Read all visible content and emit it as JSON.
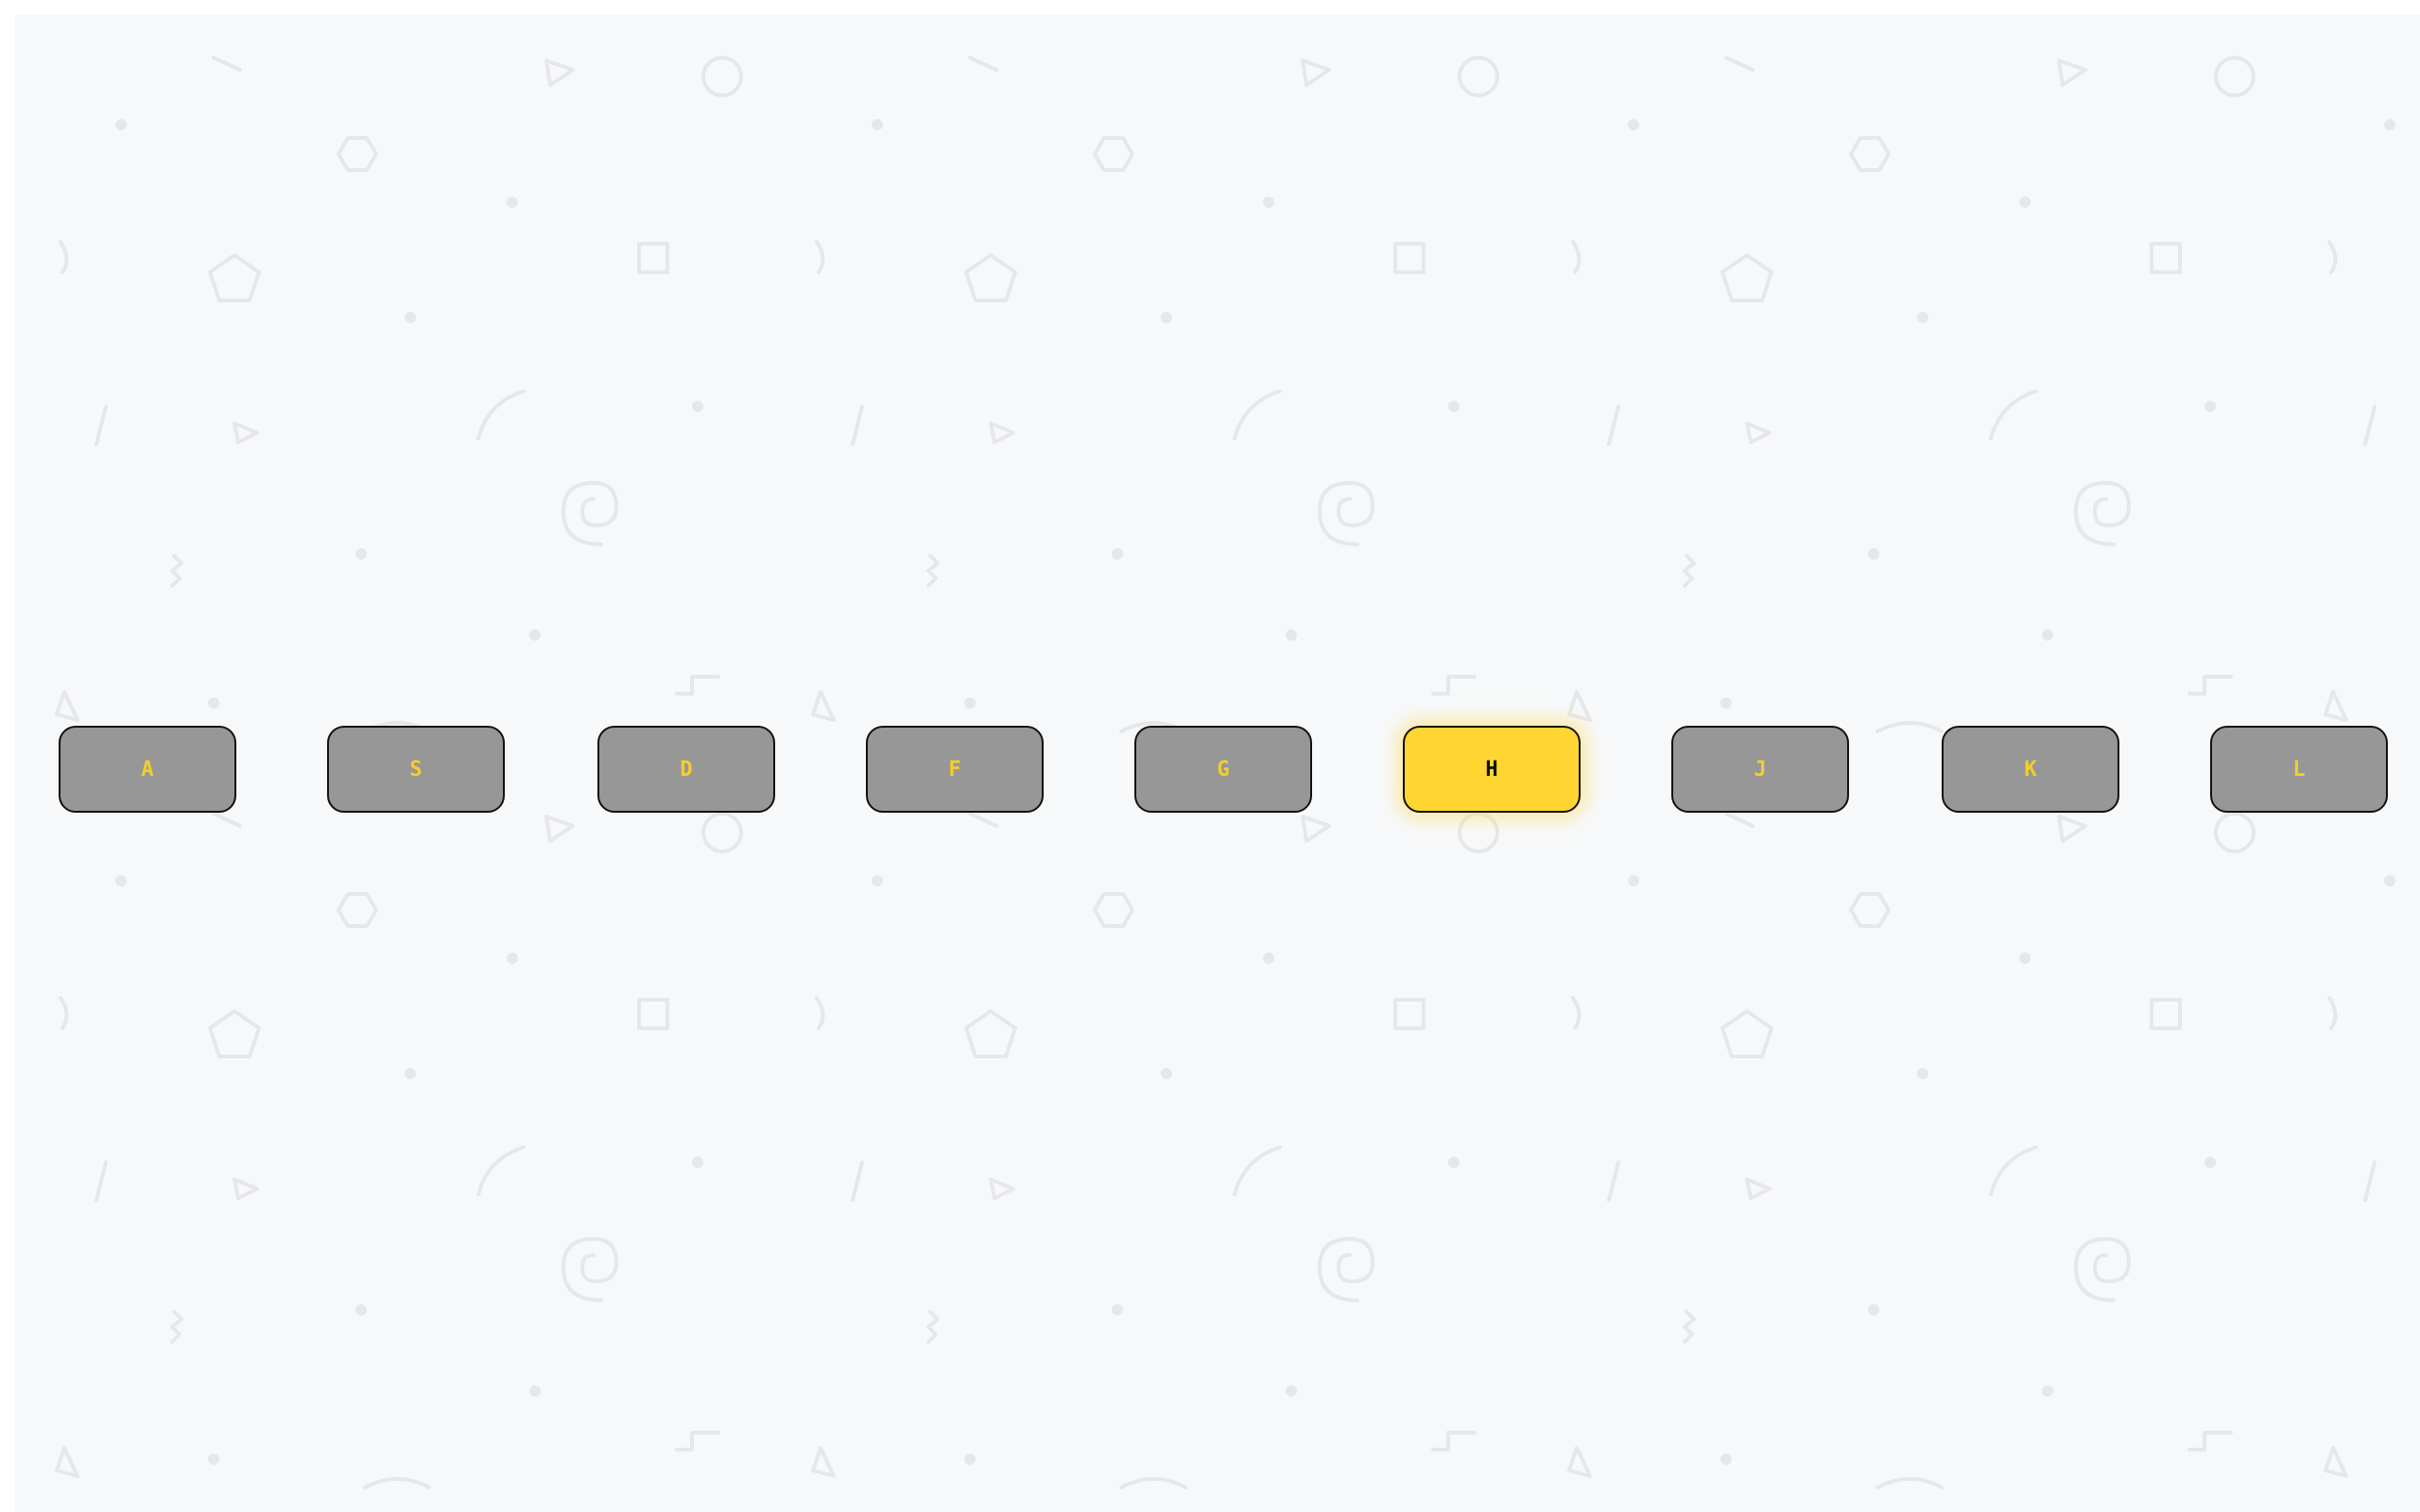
{
  "keyboard": {
    "keys": [
      {
        "label": "A",
        "active": false
      },
      {
        "label": "S",
        "active": false
      },
      {
        "label": "D",
        "active": false
      },
      {
        "label": "F",
        "active": false
      },
      {
        "label": "G",
        "active": false
      },
      {
        "label": "H",
        "active": true
      },
      {
        "label": "J",
        "active": false
      },
      {
        "label": "K",
        "active": false
      },
      {
        "label": "L",
        "active": false
      }
    ]
  },
  "colors": {
    "background": "#f7f8fa",
    "key_fill": "#979797",
    "key_text": "#f6cd2d",
    "key_active_fill": "#fed531",
    "key_active_text": "#111111",
    "pattern_stroke": "#e6e7ea"
  },
  "background_pattern": {
    "shapes": [
      "triangle-icon",
      "circle-icon",
      "dot-icon",
      "hexagon-icon",
      "square-icon",
      "pentagon-icon",
      "arc-icon",
      "spiral-icon",
      "zigzag-icon",
      "step-icon",
      "slash-icon"
    ]
  }
}
